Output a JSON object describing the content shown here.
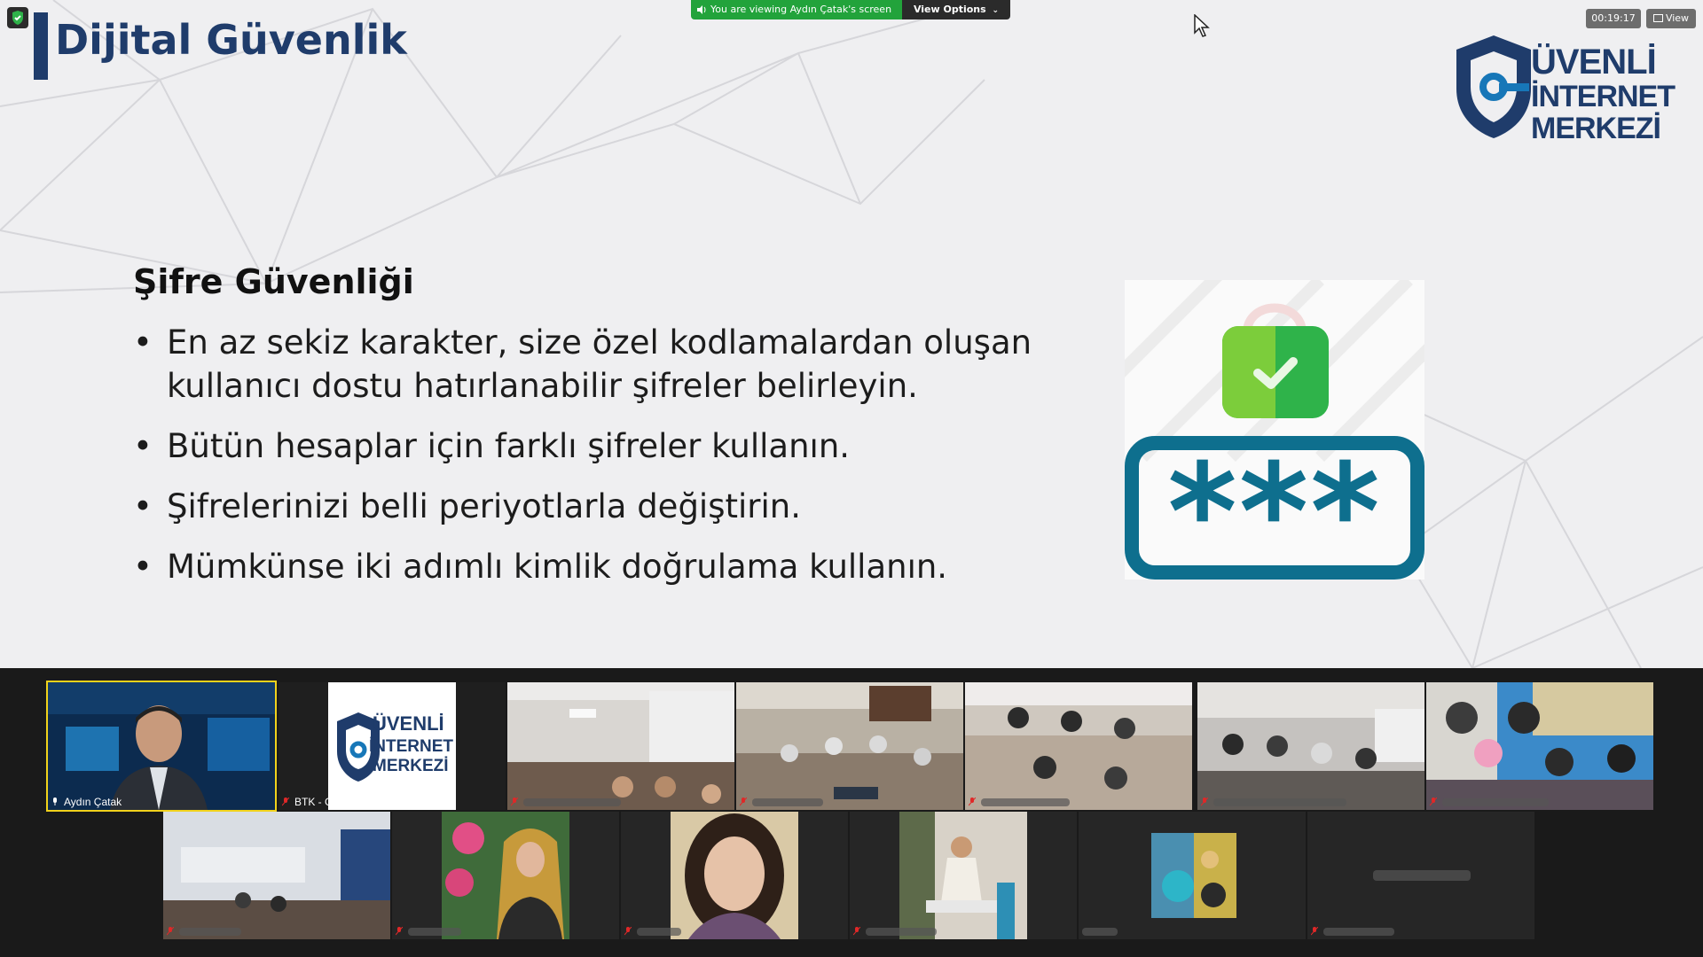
{
  "slide": {
    "title": "Dijital Güvenlik",
    "heading": "Şifre Güvenliği",
    "bullets": [
      "En az sekiz karakter, size özel kodlamalardan oluşan kullanıcı dostu hatırlanabilir şifreler belirleyin.",
      "Bütün hesaplar için farklı şifreler kullanın.",
      "Şifrelerinizi belli periyotlarla değiştirin.",
      "Mümkünse iki adımlı kimlik doğrulama kullanın."
    ],
    "logo": {
      "line1": "ÜVENLİ",
      "line2": "İNTERNET",
      "line3": "MERKEZİ"
    },
    "password_mask": "***"
  },
  "zoom": {
    "banner_text": "You are viewing Aydın Çatak's screen",
    "view_options": "View Options",
    "timer": "00:19:17",
    "view_label": "View"
  },
  "participants": {
    "row1": [
      {
        "name": "Aydın Çatak"
      },
      {
        "name": "BTK - Güvenli İnternet Merkezi"
      },
      {
        "name": ""
      },
      {
        "name": ""
      },
      {
        "name": ""
      },
      {
        "name": ""
      },
      {
        "name": ""
      }
    ],
    "row2": [
      {
        "name": ""
      },
      {
        "name": ""
      },
      {
        "name": ""
      },
      {
        "name": ""
      },
      {
        "name": ""
      },
      {
        "name": ""
      }
    ]
  },
  "colors": {
    "brand_navy": "#1f3c6b",
    "brand_blue": "#1777b8",
    "zoom_green": "#22a33b",
    "active_speaker": "#f1d21b"
  }
}
